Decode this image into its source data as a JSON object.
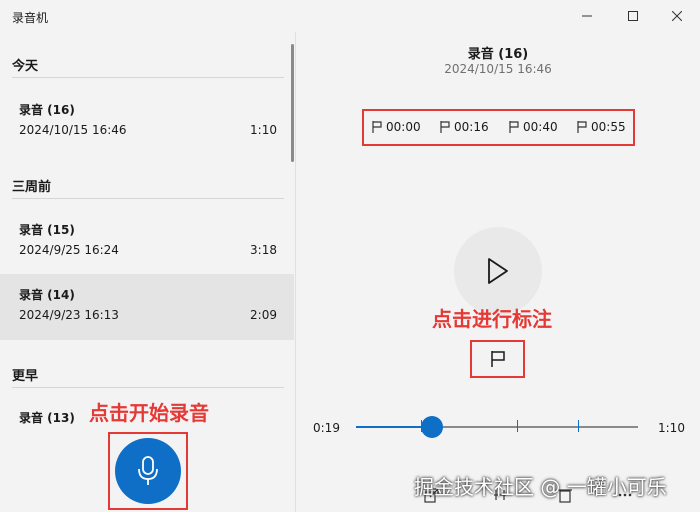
{
  "window": {
    "title": "录音机",
    "controls": [
      "minimize",
      "maximize",
      "close"
    ]
  },
  "left_pane": {
    "sections": [
      {
        "heading": "今天",
        "items": [
          {
            "name": "录音 (16)",
            "date": "2024/10/15 16:46",
            "duration": "1:10",
            "selected": false
          }
        ]
      },
      {
        "heading": "三周前",
        "items": [
          {
            "name": "录音 (15)",
            "date": "2024/9/25 16:24",
            "duration": "3:18",
            "selected": false
          },
          {
            "name": "录音 (14)",
            "date": "2024/9/23 16:13",
            "duration": "2:09",
            "selected": true
          }
        ]
      },
      {
        "heading": "更早",
        "items": [
          {
            "name": "录音 (13)"
          }
        ]
      }
    ],
    "record_annotation": "点击开始录音"
  },
  "right_pane": {
    "title": "录音 (16)",
    "date": "2024/10/15 16:46",
    "markers": [
      "00:00",
      "00:16",
      "00:40",
      "00:55"
    ],
    "marker_annotation": "点击进行标注",
    "playback": {
      "current_time": "0:19",
      "total_time": "1:10",
      "progress_fraction": 0.27,
      "marker_fractions": [
        0.0,
        0.229,
        0.571,
        0.786
      ]
    }
  },
  "watermark": "掘金技术社区 @ 一罐小可乐",
  "colors": {
    "accent": "#0f6fc6",
    "annotation_red": "#e53935"
  }
}
